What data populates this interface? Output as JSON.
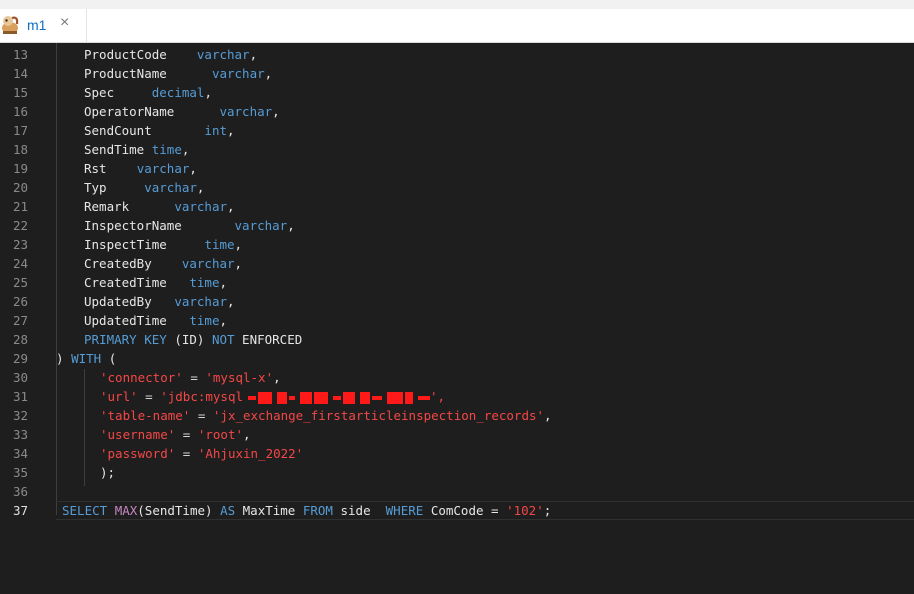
{
  "tab": {
    "label": "m1",
    "close": "×"
  },
  "lines": [
    {
      "num": "13",
      "indent": "    ",
      "name": "ProductCode",
      "gap": "    ",
      "type": "varchar",
      "end": ","
    },
    {
      "num": "14",
      "indent": "    ",
      "name": "ProductName",
      "gap": "      ",
      "type": "varchar",
      "end": ","
    },
    {
      "num": "15",
      "indent": "    ",
      "name": "Spec",
      "gap": "     ",
      "type": "decimal",
      "end": ","
    },
    {
      "num": "16",
      "indent": "    ",
      "name": "OperatorName",
      "gap": "      ",
      "type": "varchar",
      "end": ","
    },
    {
      "num": "17",
      "indent": "    ",
      "name": "SendCount",
      "gap": "       ",
      "type": "int",
      "end": ","
    },
    {
      "num": "18",
      "indent": "    ",
      "name": "SendTime",
      "gap": " ",
      "type": "time",
      "end": ","
    },
    {
      "num": "19",
      "indent": "    ",
      "name": "Rst",
      "gap": "    ",
      "type": "varchar",
      "end": ","
    },
    {
      "num": "20",
      "indent": "    ",
      "name": "Typ",
      "gap": "     ",
      "type": "varchar",
      "end": ","
    },
    {
      "num": "21",
      "indent": "    ",
      "name": "Remark",
      "gap": "      ",
      "type": "varchar",
      "end": ","
    },
    {
      "num": "22",
      "indent": "    ",
      "name": "InspectorName",
      "gap": "       ",
      "type": "varchar",
      "end": ","
    },
    {
      "num": "23",
      "indent": "    ",
      "name": "InspectTime",
      "gap": "     ",
      "type": "time",
      "end": ","
    },
    {
      "num": "24",
      "indent": "    ",
      "name": "CreatedBy",
      "gap": "    ",
      "type": "varchar",
      "end": ","
    },
    {
      "num": "25",
      "indent": "    ",
      "name": "CreatedTime",
      "gap": "   ",
      "type": "time",
      "end": ","
    },
    {
      "num": "26",
      "indent": "    ",
      "name": "UpdatedBy",
      "gap": "   ",
      "type": "varchar",
      "end": ","
    },
    {
      "num": "27",
      "indent": "    ",
      "name": "UpdatedTime",
      "gap": "   ",
      "type": "time",
      "end": ","
    }
  ],
  "line28": {
    "num": "28",
    "kw1": "PRIMARY KEY",
    "mid": " (ID) ",
    "kw2": "NOT",
    "tail": " ENFORCED"
  },
  "line29": {
    "num": "29",
    "pre": ") ",
    "kw": "WITH",
    "post": " ("
  },
  "props": [
    {
      "num": "30",
      "key": "'connector'",
      "eq": " = ",
      "val": "'mysql-x'",
      "end": ","
    },
    {
      "num": "31",
      "key": "'url'",
      "eq": " = ",
      "val": "'jdbc:mysql",
      "end": "',",
      "redacted": true
    },
    {
      "num": "32",
      "key": "'table-name'",
      "eq": " = ",
      "val": "'jx_exchange_firstarticleinspection_records'",
      "end": ","
    },
    {
      "num": "33",
      "key": "'username'",
      "eq": " = ",
      "val": "'root'",
      "end": ","
    },
    {
      "num": "34",
      "key": "'password'",
      "eq": " = ",
      "val": "'Ahjuxin_2022'",
      "end": ""
    }
  ],
  "line35": {
    "num": "35",
    "text": ");"
  },
  "line36": {
    "num": "36"
  },
  "line37": {
    "num": "37",
    "select": "SELECT",
    "max": "MAX",
    "arg": "(SendTime) ",
    "as": "AS",
    "alias": " MaxTime ",
    "from": "FROM",
    "table": " side  ",
    "where": "WHERE",
    "col": " ComCode = ",
    "val": "'102'",
    "end": ";"
  },
  "colors": {
    "keyword": "#569cd6",
    "function": "#c586c0",
    "string": "#f44747",
    "text": "#e6e6e6",
    "background": "#1e1e1e"
  }
}
